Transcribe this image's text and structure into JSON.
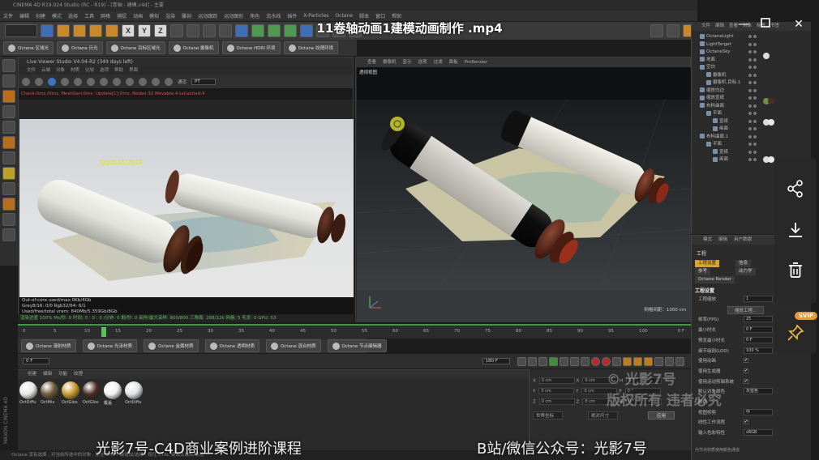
{
  "window": {
    "app_title": "CINEMA 4D R19.024 Studio (RC - R19) - [卷轴 - 建模.c4d] - 主要"
  },
  "menubar": [
    "文件",
    "编辑",
    "创建",
    "模式",
    "选择",
    "工具",
    "网格",
    "捕捉",
    "动画",
    "模拟",
    "渲染",
    "雕刻",
    "运动跟踪",
    "运动图形",
    "角色",
    "流水线",
    "插件",
    "X-Particles",
    "Octane",
    "脚本",
    "窗口",
    "帮助"
  ],
  "toolbar": {
    "axis_x": "X",
    "axis_y": "Y",
    "axis_z": "Z"
  },
  "octane_toolbar": [
    "Octane 区域光",
    "Octane 日光",
    "Octane 目标区域光",
    "Octane 摄像机",
    "Octane HDRI 环境",
    "Octane 纹理环境"
  ],
  "live_viewer": {
    "title": "Live Viewer Studio V4.04-R2 (349 days left)",
    "menu": [
      "文件",
      "云端",
      "对象",
      "材质",
      "比较",
      "选项",
      "帮助",
      "界面"
    ],
    "channel_label": "通道",
    "channel_value": "PT",
    "stats_line": "Check:0ms./0ms. MeshGen:0ms. Update[C]:0ms. Nodes:32 Movable:4 txCached:4",
    "info": [
      "Out-of-core used/max:0Kb/4Gb",
      "Grey8/16: 0/0          Rgb32/64: 6/1",
      "Used/free/total vram: 840Mb/5.359Gb/8Gb"
    ],
    "status": "渲染进度 100%   Ms/秒: 0   时间: 0 : 0 : 0   /分钟: 0   剩/秒: 0   采样/最大采样: 800/800   三角面: 288/12k   网格: 5   毛发: 0   GPU: 53"
  },
  "qq_watermark": "QQ253377019",
  "viewport": {
    "menu": [
      "查看",
      "摄像机",
      "显示",
      "选项",
      "过滤",
      "面板",
      "ProRender"
    ],
    "label": "透视视图",
    "grid_info": "网格间距：1000 cm"
  },
  "timeline": {
    "ticks": [
      "0",
      "5",
      "10",
      "15",
      "20",
      "25",
      "30",
      "35",
      "40",
      "45",
      "50",
      "55",
      "60",
      "65",
      "70",
      "75",
      "80",
      "85",
      "90",
      "95",
      "100"
    ],
    "current_frame_display": "0 F",
    "frame_field_left": "0 F",
    "frame_field_right": "180 F",
    "end_frame": "0 F"
  },
  "octane_materials_bar": [
    "Octane 漫射材质",
    "Octane 光泽材质",
    "Octane 金属材质",
    "Octane 透明材质",
    "Octane 混合材质",
    "Octane 节点编辑器"
  ],
  "material_manager": {
    "menu": [
      "创建",
      "编辑",
      "功能",
      "纹理"
    ],
    "materials": [
      {
        "name": "OctDiffu",
        "color": "#e8e8e4"
      },
      {
        "name": "OctMix",
        "color": "#6b5a3a"
      },
      {
        "name": "OctGlos",
        "color": "#c99a2e"
      },
      {
        "name": "OctGlos",
        "color": "#4a2e22"
      },
      {
        "name": "覆盖",
        "color": "#f2f2f2"
      },
      {
        "name": "OctDiffu",
        "color": "#dfe4e6"
      }
    ]
  },
  "coordinates": {
    "rows": [
      {
        "axis": "X",
        "pos": "0 cm",
        "size": "0 cm",
        "rot_label": "H",
        "rot": "0 °"
      },
      {
        "axis": "Y",
        "pos": "0 cm",
        "size": "0 cm",
        "rot_label": "P",
        "rot": "0 °"
      },
      {
        "axis": "Z",
        "pos": "0 cm",
        "size": "0 cm",
        "rot_label": "B",
        "rot": "0 °"
      }
    ],
    "mode_left": "世界坐标",
    "mode_right": "绝对尺寸",
    "apply": "应用"
  },
  "watermark": {
    "line1": "© 光影7号",
    "line2": "版权所有 违者必究"
  },
  "object_manager": {
    "menu": [
      "文件",
      "编辑",
      "查看",
      "对象",
      "标签",
      "书签"
    ],
    "objects": [
      {
        "name": "OctaneLight",
        "indent": 0
      },
      {
        "name": "LightTarget",
        "indent": 0
      },
      {
        "name": "OctaneSky",
        "indent": 0
      },
      {
        "name": "地面",
        "indent": 0
      },
      {
        "name": "空白",
        "indent": 0
      },
      {
        "name": "摄像机",
        "indent": 1
      },
      {
        "name": "摄像机.目标.1",
        "indent": 1
      },
      {
        "name": "缩放白边",
        "indent": 0
      },
      {
        "name": "缩放宣纸",
        "indent": 0
      },
      {
        "name": "布料曲面",
        "indent": 0
      },
      {
        "name": "平面",
        "indent": 1
      },
      {
        "name": "宣纸",
        "indent": 2
      },
      {
        "name": "画面",
        "indent": 2
      },
      {
        "name": "布料曲面.1",
        "indent": 0
      },
      {
        "name": "平面",
        "indent": 1
      },
      {
        "name": "宣纸",
        "indent": 2
      },
      {
        "name": "画面",
        "indent": 2
      }
    ]
  },
  "attribute_manager": {
    "menu": [
      "模式",
      "编辑",
      "用户数据"
    ],
    "object": "工程",
    "tabs": [
      "工程设置",
      "信息",
      "参考",
      "动力学",
      "Octane Render"
    ],
    "section": "工程设置",
    "rows": [
      {
        "label": "工程缩放",
        "value": "1"
      },
      {
        "label": "缩放工程...",
        "value": ""
      },
      {
        "label": "帧率(FPS)",
        "value": "25"
      },
      {
        "label": "最小时长",
        "value": "0 F"
      },
      {
        "label": "预览最小时长",
        "value": "0 F"
      },
      {
        "label": "细节级别(LOD)",
        "value": "100 %"
      },
      {
        "label": "使用动画",
        "value": "✔"
      },
      {
        "label": "使用生成器",
        "value": "✔"
      },
      {
        "label": "使用运动剪辑系统",
        "value": "✔"
      },
      {
        "label": "默认对象颜色",
        "value": "灰蓝色"
      },
      {
        "label": "颜色",
        "value": ""
      },
      {
        "label": "视图修剪",
        "value": "中"
      },
      {
        "label": "线性工作流程",
        "value": "✔"
      },
      {
        "label": "输入色彩特性",
        "value": "sRGB"
      }
    ],
    "footer": "为节点材质使用颜色通道"
  },
  "status_bar": "Octane    没有选择 , 对当前所选中的对象 , 按住 SHIFT 键增加/选择 , 按住 CTRL 键减去选择/取消",
  "maxon_logo": "MAXON CINEMA 4D",
  "overlays": {
    "video_title": "11卷轴动画1建模动画制作 .mp4",
    "svip": "SVIP",
    "course_left": "光影7号-C4D商业案例进阶课程",
    "course_right": "B站/微信公众号：光影7号",
    "side_icons": [
      "share-icon",
      "download-icon",
      "delete-icon",
      "pin-icon"
    ]
  }
}
